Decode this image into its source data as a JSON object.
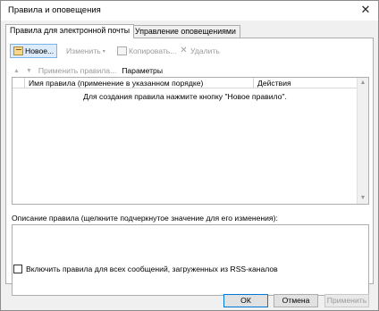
{
  "window": {
    "title": "Правила и оповещения"
  },
  "tabs": [
    {
      "label": "Правила для электронной почты"
    },
    {
      "label": "Управление оповещениями"
    }
  ],
  "toolbar": {
    "new_label": "Новое...",
    "change_label": "Изменить",
    "copy_label": "Копировать...",
    "delete_label": "Удалить"
  },
  "row2": {
    "apply_rules_label": "Применить правила...",
    "params_label": "Параметры"
  },
  "rules_list": {
    "col_name": "Имя правила (применение в указанном порядке)",
    "col_actions": "Действия",
    "empty_text": "Для создания правила нажмите кнопку \"Новое правило\"."
  },
  "description": {
    "label": "Описание правила (щелкните подчеркнутое значение для его изменения):"
  },
  "rss": {
    "label": "Включить правила для всех сообщений, загруженных из RSS-каналов",
    "checked": false
  },
  "buttons": {
    "ok": "ОК",
    "cancel": "Отмена",
    "apply": "Применить"
  },
  "icons": {
    "close": "close-icon",
    "new": "new-rule-icon",
    "copy": "copy-icon",
    "delete": "delete-icon"
  }
}
